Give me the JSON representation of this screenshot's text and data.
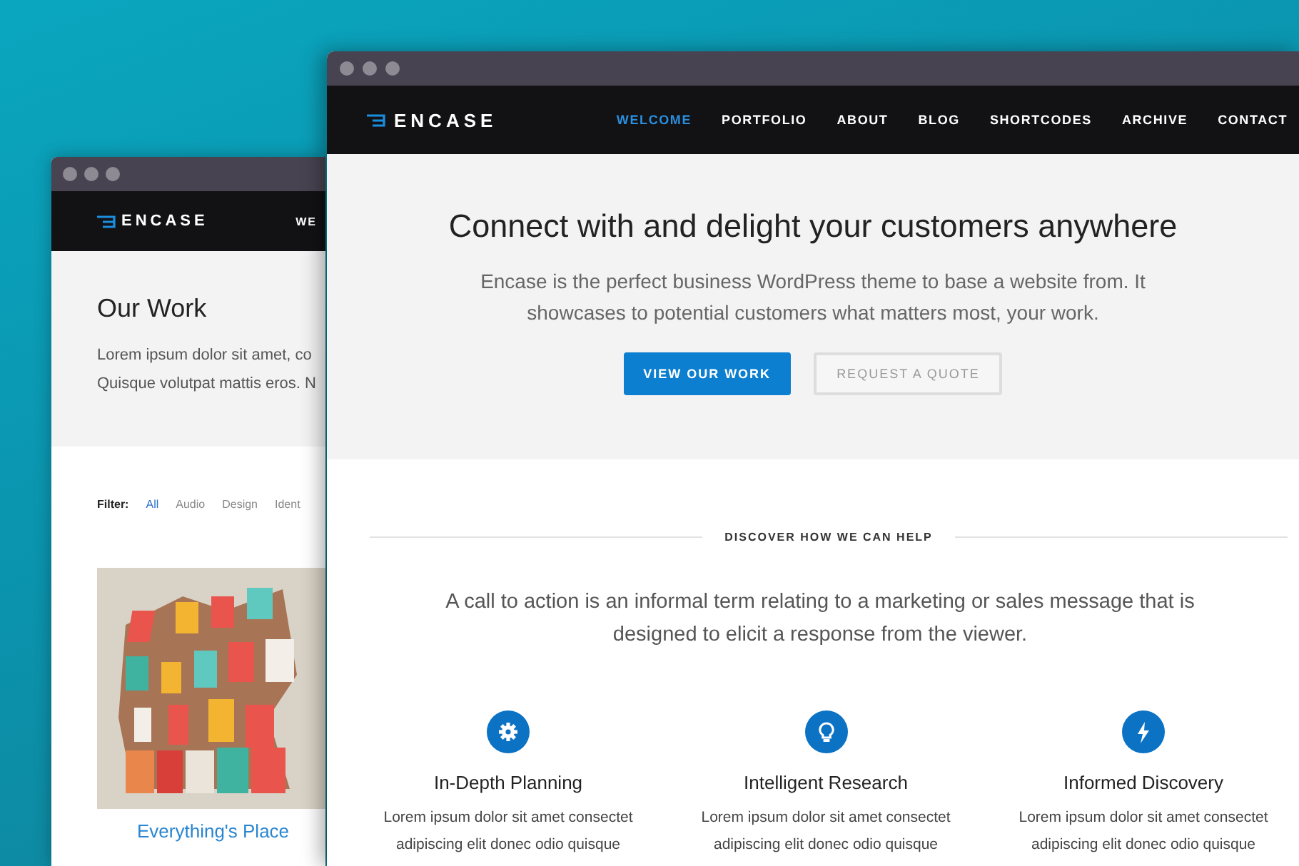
{
  "back_window": {
    "logo": "ENCASE",
    "nav": [
      {
        "label": "WE",
        "selected": false
      }
    ],
    "page_title": "Our Work",
    "intro": [
      "Lorem ipsum dolor sit amet, co",
      "Quisque volutpat mattis eros. N"
    ],
    "filter_label": "Filter:",
    "filters": [
      {
        "label": "All",
        "selected": true
      },
      {
        "label": "Audio",
        "selected": false
      },
      {
        "label": "Design",
        "selected": false
      },
      {
        "label": "Ident",
        "selected": false
      }
    ],
    "portfolio_item": {
      "title": "Everything's Place"
    }
  },
  "front_window": {
    "logo": "ENCASE",
    "nav": [
      {
        "label": "WELCOME",
        "selected": true
      },
      {
        "label": "PORTFOLIO",
        "selected": false
      },
      {
        "label": "ABOUT",
        "selected": false
      },
      {
        "label": "BLOG",
        "selected": false
      },
      {
        "label": "SHORTCODES",
        "selected": false
      },
      {
        "label": "ARCHIVE",
        "selected": false
      },
      {
        "label": "CONTACT",
        "selected": false
      }
    ],
    "hero_heading": "Connect with and delight your customers anywhere",
    "hero_text": "Encase is the perfect business WordPress theme to base a website from. It showcases to potential customers what matters most, your work.",
    "buttons": [
      {
        "label": "VIEW OUR WORK",
        "kind": "primary"
      },
      {
        "label": "REQUEST A QUOTE",
        "kind": "secondary"
      }
    ],
    "section_label": "DISCOVER HOW WE CAN HELP",
    "section_text": "A call to action is an informal term relating to a marketing or sales message that is designed to elicit a response from the viewer.",
    "features": [
      {
        "kind": "gear",
        "title": "In-Depth Planning",
        "text": "Lorem ipsum dolor sit amet consectet adipiscing elit donec odio quisque"
      },
      {
        "kind": "bulb",
        "title": "Intelligent Research",
        "text": "Lorem ipsum dolor sit amet consectet adipiscing elit donec odio quisque"
      },
      {
        "kind": "bolt",
        "title": "Informed Discovery",
        "text": "Lorem ipsum dolor sit amet consectet adipiscing elit donec odio quisque"
      }
    ]
  }
}
